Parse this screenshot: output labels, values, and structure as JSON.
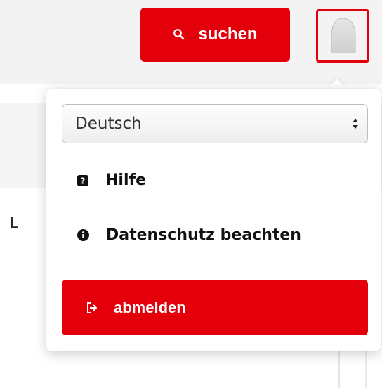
{
  "header": {
    "search_label": "suchen",
    "search_icon": "search-icon",
    "avatar_icon": "user-avatar-icon"
  },
  "background": {
    "letter": "L"
  },
  "user_menu": {
    "language": {
      "selected": "Deutsch"
    },
    "items": [
      {
        "label": "Hilfe",
        "icon": "question-square-icon"
      },
      {
        "label": "Datenschutz beachten",
        "icon": "info-circle-icon"
      }
    ],
    "logout_label": "abmelden",
    "logout_icon": "sign-out-icon"
  },
  "colors": {
    "accent": "#e3000b",
    "topbar_bg": "#f3f3f3"
  }
}
